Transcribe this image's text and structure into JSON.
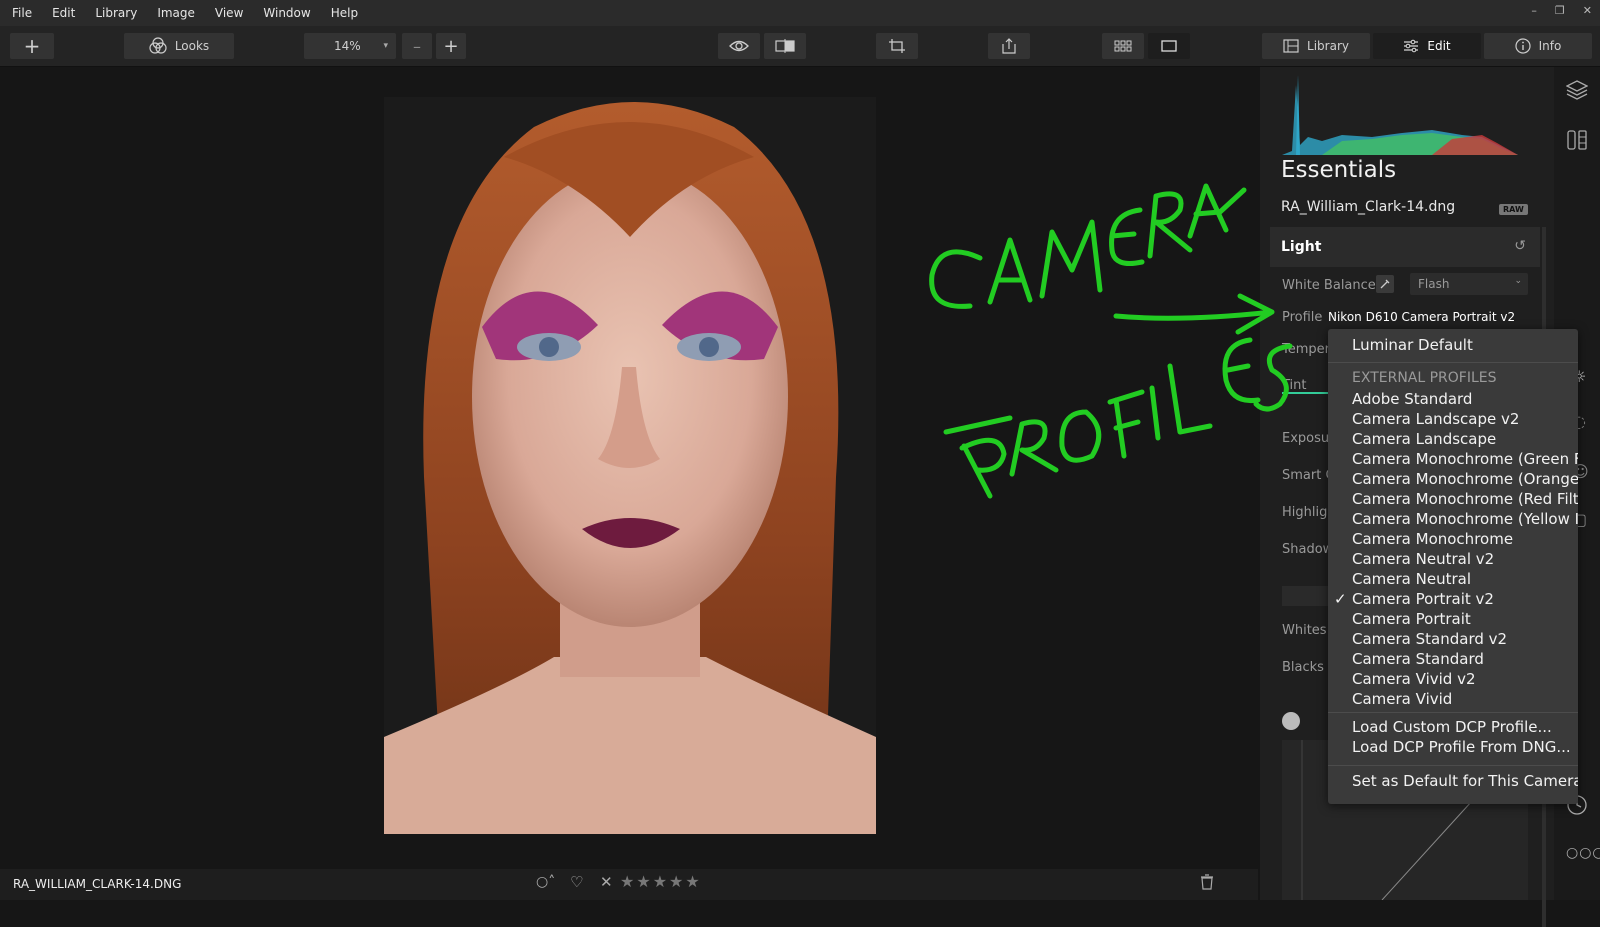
{
  "menubar": {
    "items": [
      "File",
      "Edit",
      "Library",
      "Image",
      "View",
      "Window",
      "Help"
    ],
    "window_controls": [
      "–",
      "❐",
      "✕"
    ]
  },
  "toolbar": {
    "add_label": "+",
    "looks_label": "Looks",
    "zoom_value": "14%",
    "zoom_out": "–",
    "zoom_in": "+",
    "tabs": [
      "Library",
      "Edit",
      "Info"
    ]
  },
  "bottombar": {
    "filename": "RA_WILLIAM_CLARK-14.DNG",
    "stars": "★★★★★"
  },
  "panel": {
    "title": "Essentials",
    "filename": "RA_William_Clark-14.dng",
    "raw_badge": "RAW",
    "section": "Light",
    "white_balance_label": "White Balance",
    "white_balance_value": "Flash",
    "profile_label": "Profile",
    "profile_value": "Nikon D610 Camera Portrait v2",
    "slider_labels": [
      "Tempera",
      "Tint",
      "Exposur",
      "Smart C",
      "Highligh",
      "Shadow",
      "Whites",
      "Blacks"
    ]
  },
  "profile_menu": {
    "default_item": "Luminar Default",
    "group_header": "EXTERNAL PROFILES",
    "items": [
      "Adobe Standard",
      "Camera Landscape v2",
      "Camera Landscape",
      "Camera Monochrome (Green F",
      "Camera Monochrome (Orange",
      "Camera Monochrome (Red Filt",
      "Camera Monochrome (Yellow I",
      "Camera Monochrome",
      "Camera Neutral v2",
      "Camera Neutral",
      "Camera Portrait v2",
      "Camera Portrait",
      "Camera Standard v2",
      "Camera Standard",
      "Camera Vivid v2",
      "Camera Vivid"
    ],
    "selected_index": 10,
    "check_mark": "✓",
    "load_custom": "Load Custom DCP Profile...",
    "load_from_dng": "Load DCP Profile From DNG...",
    "set_default": "Set as Default for This Camera"
  },
  "annotation": {
    "words": [
      "CAMERA",
      "PROFILES"
    ],
    "color": "#22cc22"
  },
  "colors": {
    "accent_green": "#22cc22",
    "panel_bg": "#1f1f1f",
    "menu_bg": "#3a3a3a"
  }
}
